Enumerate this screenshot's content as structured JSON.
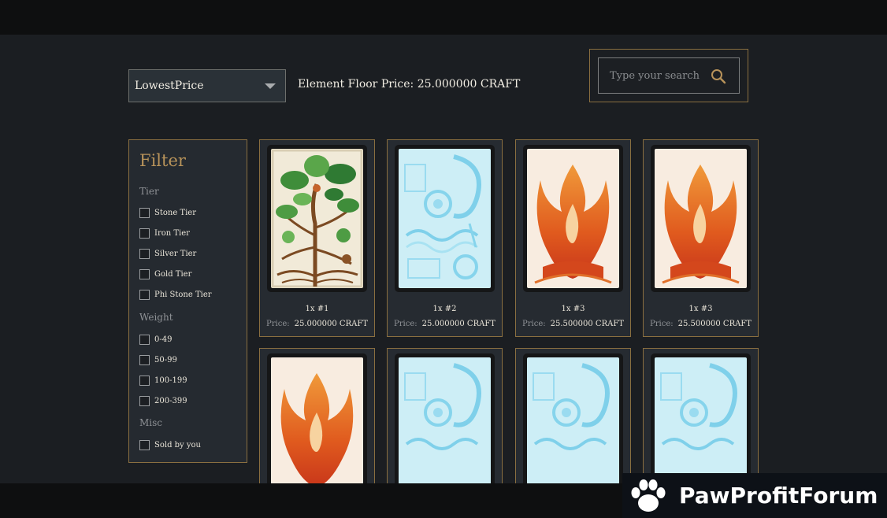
{
  "sort": {
    "selected": "LowestPrice"
  },
  "floor_price": "Element Floor Price: 25.000000 CRAFT",
  "search": {
    "placeholder": "Type your search",
    "icon": "search-icon"
  },
  "filter": {
    "title": "Filter",
    "groups": [
      {
        "label": "Tier",
        "options": [
          "Stone Tier",
          "Iron Tier",
          "Silver Tier",
          "Gold Tier",
          "Phi Stone Tier"
        ]
      },
      {
        "label": "Weight",
        "options": [
          "0-49",
          "50-99",
          "100-199",
          "200-399"
        ]
      },
      {
        "label": "Misc",
        "options": [
          "Sold by you"
        ]
      }
    ]
  },
  "cards": [
    {
      "art": "earth",
      "qty": "1x #1",
      "price_label": "Price:",
      "price": "25.000000 CRAFT"
    },
    {
      "art": "water",
      "qty": "1x #2",
      "price_label": "Price:",
      "price": "25.000000 CRAFT"
    },
    {
      "art": "fire",
      "qty": "1x #3",
      "price_label": "Price:",
      "price": "25.500000 CRAFT"
    },
    {
      "art": "fire",
      "qty": "1x #3",
      "price_label": "Price:",
      "price": "25.500000 CRAFT"
    },
    {
      "art": "fire"
    },
    {
      "art": "water"
    },
    {
      "art": "water"
    },
    {
      "art": "water"
    }
  ],
  "colors": {
    "accent_gold": "#b8935a",
    "border_gold": "#8a6f40",
    "background": "#1b1e22"
  },
  "watermark": {
    "text": "PawProfitForum",
    "icon": "paw-icon"
  }
}
